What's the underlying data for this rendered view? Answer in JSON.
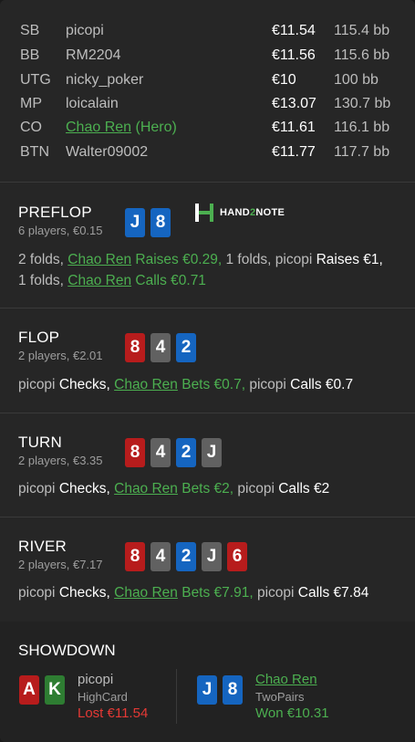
{
  "players": [
    {
      "pos": "SB",
      "name": "picopi",
      "stack": "€11.54",
      "bb": "115.4 bb"
    },
    {
      "pos": "BB",
      "name": "RM2204",
      "stack": "€11.56",
      "bb": "115.6 bb"
    },
    {
      "pos": "UTG",
      "name": "nicky_poker",
      "stack": "€10",
      "bb": "100 bb"
    },
    {
      "pos": "MP",
      "name": "loicalain",
      "stack": "€13.07",
      "bb": "130.7 bb"
    },
    {
      "pos": "CO",
      "name": "Chao Ren",
      "hero_tag": "(Hero)",
      "stack": "€11.61",
      "bb": "116.1 bb"
    },
    {
      "pos": "BTN",
      "name": "Walter09002",
      "stack": "€11.77",
      "bb": "117.7 bb"
    }
  ],
  "logo": {
    "prefix": "HAND",
    "mid": "2",
    "suffix": "NOTE"
  },
  "preflop": {
    "title": "PREFLOP",
    "sub": "6 players, €0.15",
    "cards": [
      {
        "rank": "J",
        "color": "blue"
      },
      {
        "rank": "8",
        "color": "blue"
      }
    ],
    "a1": "2 folds, ",
    "hero": "Chao Ren",
    "a2": " Raises €0.29,",
    "a3": " 1 folds, picopi ",
    "a4": "Raises €1,",
    "a5": "1 folds, ",
    "hero2": "Chao Ren",
    "a6": " Calls €0.71"
  },
  "flop": {
    "title": "FLOP",
    "sub": "2 players, €2.01",
    "cards": [
      {
        "rank": "8",
        "color": "red"
      },
      {
        "rank": "4",
        "color": "grey"
      },
      {
        "rank": "2",
        "color": "blue"
      }
    ],
    "a1": "picopi ",
    "a2": "Checks,",
    "hero": "Chao Ren",
    "a3": " Bets €0.7,",
    "a4": " picopi ",
    "a5": "Calls €0.7"
  },
  "turn": {
    "title": "TURN",
    "sub": "2 players, €3.35",
    "cards": [
      {
        "rank": "8",
        "color": "red"
      },
      {
        "rank": "4",
        "color": "grey"
      },
      {
        "rank": "2",
        "color": "blue"
      },
      {
        "rank": "J",
        "color": "grey"
      }
    ],
    "a1": "picopi ",
    "a2": "Checks,",
    "hero": "Chao Ren",
    "a3": " Bets €2,",
    "a4": " picopi ",
    "a5": "Calls €2"
  },
  "river": {
    "title": "RIVER",
    "sub": "2 players, €7.17",
    "cards": [
      {
        "rank": "8",
        "color": "red"
      },
      {
        "rank": "4",
        "color": "grey"
      },
      {
        "rank": "2",
        "color": "blue"
      },
      {
        "rank": "J",
        "color": "grey"
      },
      {
        "rank": "6",
        "color": "red"
      }
    ],
    "a1": "picopi ",
    "a2": "Checks,",
    "hero": "Chao Ren",
    "a3": " Bets €7.91,",
    "a4": " picopi ",
    "a5": "Calls €7.84"
  },
  "showdown": {
    "title": "SHOWDOWN",
    "villain": {
      "cards": [
        {
          "rank": "A",
          "color": "red"
        },
        {
          "rank": "K",
          "color": "green"
        }
      ],
      "name": "picopi",
      "hand": "HighCard",
      "result": "Lost €11.54"
    },
    "hero": {
      "cards": [
        {
          "rank": "J",
          "color": "blue"
        },
        {
          "rank": "8",
          "color": "blue"
        }
      ],
      "name": "Chao Ren",
      "hand": "TwoPairs",
      "result": "Won €10.31"
    }
  },
  "colors": {
    "hero": "#4caf50",
    "lost": "#e53935",
    "red_card": "#b71c1c",
    "blue_card": "#1565c0",
    "grey_card": "#616161",
    "green_card": "#2e7d32"
  }
}
